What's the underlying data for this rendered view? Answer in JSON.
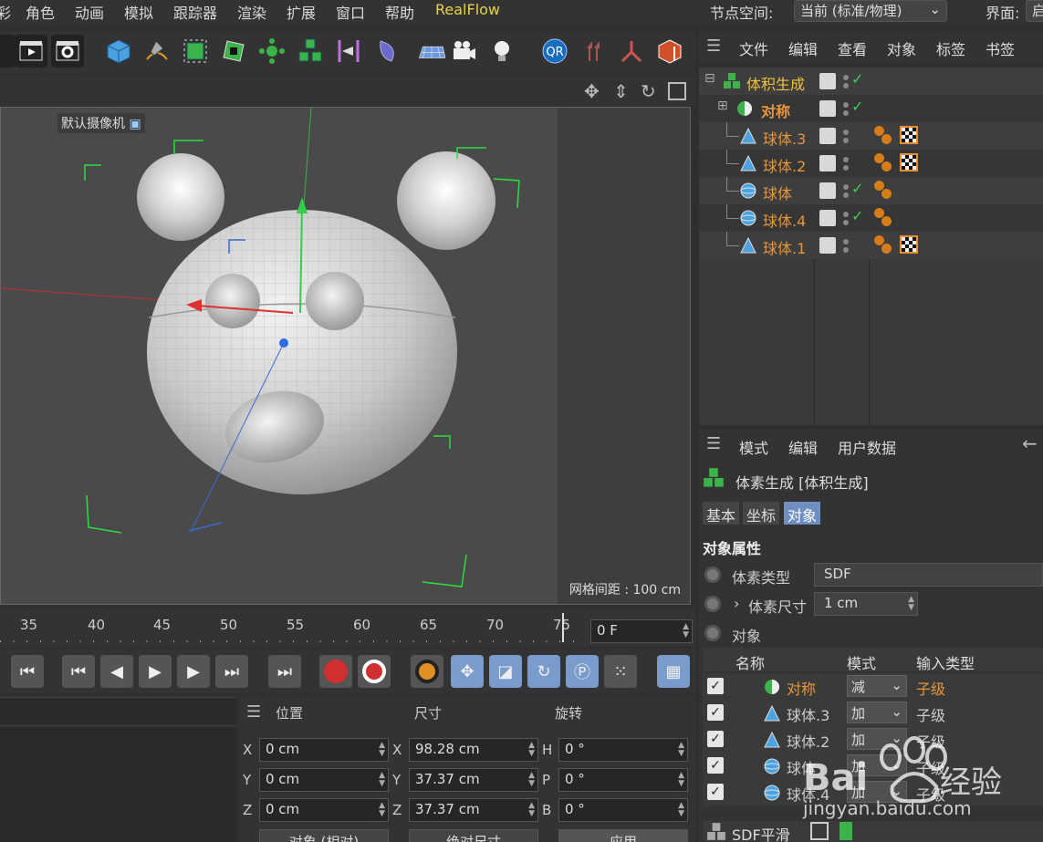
{
  "menu": {
    "items": [
      "彩",
      "角色",
      "动画",
      "模拟",
      "跟踪器",
      "渲染",
      "扩展",
      "窗口",
      "帮助",
      "RealFlow"
    ],
    "node_space_label": "节点空间:",
    "node_space_value": "当前 (标准/物理)",
    "interface_label": "界面:",
    "interface_value": "启"
  },
  "viewport": {
    "camera_label": "默认摄像机",
    "grid_label": "网格间距 : 100 cm",
    "bg_color": "#4a4a4a"
  },
  "timeline": {
    "ticks": [
      "35",
      "40",
      "45",
      "50",
      "55",
      "60",
      "65",
      "70",
      "75"
    ],
    "current_frame": "0 F"
  },
  "coordinates": {
    "headers": {
      "position": "位置",
      "size": "尺寸",
      "rotation": "旋转"
    },
    "rows": [
      {
        "axis": "X",
        "pos": "0 cm",
        "size_axis": "X",
        "size": "98.28 cm",
        "rot_axis": "H",
        "rot": "0 °"
      },
      {
        "axis": "Y",
        "pos": "0 cm",
        "size_axis": "Y",
        "size": "37.37 cm",
        "rot_axis": "P",
        "rot": "0 °"
      },
      {
        "axis": "Z",
        "pos": "0 cm",
        "size_axis": "Z",
        "size": "37.37 cm",
        "rot_axis": "B",
        "rot": "0 °"
      }
    ],
    "mode_dropdown": "对象 (相对)",
    "size_dropdown": "绝对尺寸",
    "apply_button": "应用"
  },
  "object_manager": {
    "menu": [
      "文件",
      "编辑",
      "查看",
      "对象",
      "标签",
      "书签"
    ],
    "objects": [
      {
        "name": "体积生成",
        "icon": "volume-builder-icon",
        "enabled": true
      },
      {
        "name": "对称",
        "icon": "symmetry-icon",
        "enabled": true
      },
      {
        "name": "球体.3",
        "icon": "cone-icon",
        "enabled": false
      },
      {
        "name": "球体.2",
        "icon": "cone-icon",
        "enabled": false
      },
      {
        "name": "球体",
        "icon": "sphere-icon",
        "enabled": true
      },
      {
        "name": "球体.4",
        "icon": "sphere-icon",
        "enabled": true
      },
      {
        "name": "球体.1",
        "icon": "cone-icon",
        "enabled": false
      }
    ]
  },
  "attributes": {
    "menu": [
      "模式",
      "编辑",
      "用户数据"
    ],
    "object_title": "体素生成 [体积生成]",
    "tabs": [
      "基本",
      "坐标",
      "对象"
    ],
    "active_tab": "对象",
    "section_title": "对象属性",
    "voxel_type_label": "体素类型",
    "voxel_type_value": "SDF",
    "voxel_size_label": "体素尺寸",
    "voxel_size_value": "1 cm",
    "objects_label": "对象",
    "table_headers": [
      "名称",
      "模式",
      "输入类型"
    ],
    "table_rows": [
      {
        "name": "对称",
        "mode": "减",
        "type": "子级",
        "highlight": true
      },
      {
        "name": "球体.3",
        "mode": "加",
        "type": "子级",
        "highlight": false
      },
      {
        "name": "球体.2",
        "mode": "加",
        "type": "子级",
        "highlight": false
      },
      {
        "name": "球体",
        "mode": "加",
        "type": "子级",
        "highlight": false
      },
      {
        "name": "球体.4",
        "mode": "加",
        "type": "子级",
        "highlight": false
      }
    ],
    "footer_item": "SDF平滑"
  },
  "watermark": {
    "brand": "Bai",
    "brand_cn": "经验",
    "url": "jingyan.baidu.com"
  }
}
